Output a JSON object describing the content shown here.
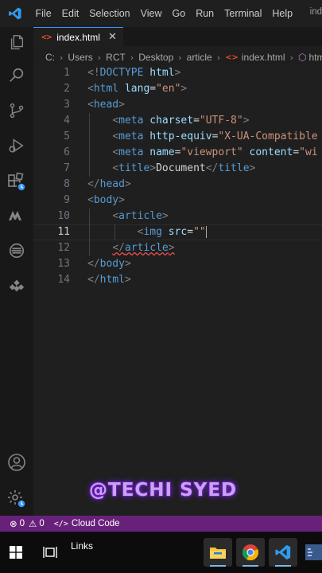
{
  "menubar": {
    "items": [
      "File",
      "Edit",
      "Selection",
      "View",
      "Go",
      "Run",
      "Terminal",
      "Help"
    ],
    "title_fragment": "ind"
  },
  "activity_bar": {
    "icons": [
      "explorer-icon",
      "search-icon",
      "source-control-icon",
      "run-debug-icon",
      "extensions-icon",
      "remote-icon",
      "docker-icon",
      "gemini-icon",
      "account-icon",
      "settings-icon"
    ]
  },
  "tab": {
    "label": "index.html",
    "close": "✕"
  },
  "breadcrumbs": [
    "C:",
    "Users",
    "RCT",
    "Desktop",
    "article",
    "index.html",
    "html",
    ""
  ],
  "editor": {
    "line_numbers": [
      "1",
      "2",
      "3",
      "4",
      "5",
      "6",
      "7",
      "8",
      "9",
      "10",
      "11",
      "12",
      "13",
      "14"
    ],
    "active_line": "11"
  },
  "watermark": "@TECHI SYED",
  "statusbar": {
    "errors": "0",
    "warnings": "0",
    "cloud_code": "Cloud Code"
  },
  "taskbar": {
    "links_label": "Links"
  },
  "colors": {
    "status_bar": "#68217a",
    "accent": "#3794ff",
    "watermark": "#c9a3f3"
  }
}
